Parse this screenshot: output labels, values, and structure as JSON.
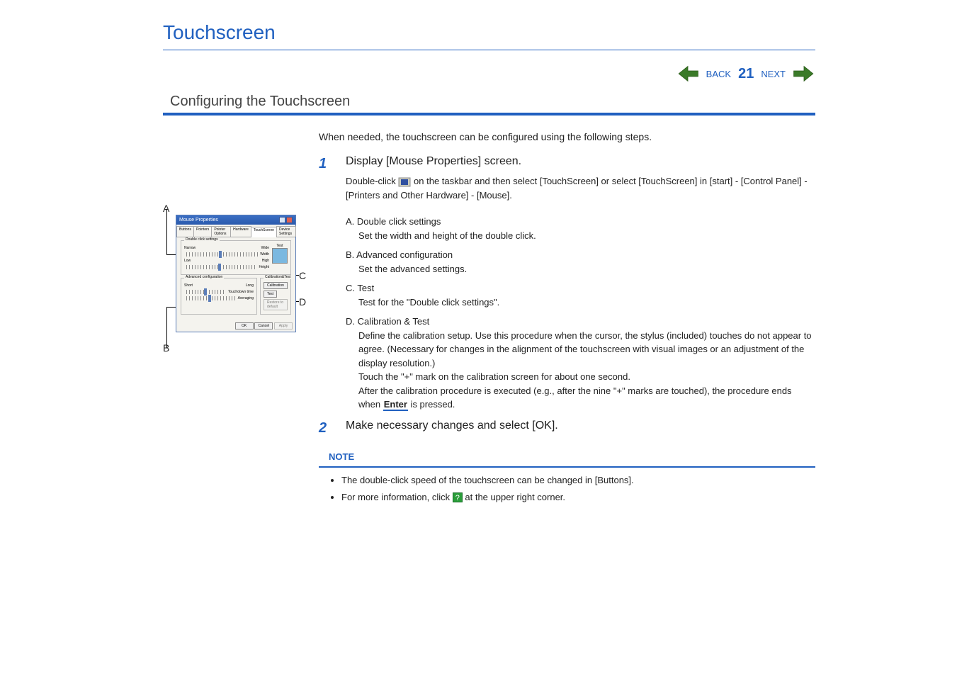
{
  "title": "Touchscreen",
  "nav": {
    "back": "BACK",
    "page": "21",
    "next": "NEXT"
  },
  "subtitle": "Configuring the Touchscreen",
  "intro": "When needed, the touchscreen can be configured using the following steps.",
  "step1": {
    "num": "1",
    "head": "Display [Mouse Properties] screen.",
    "sub_a": "Double-click ",
    "sub_b": " on the taskbar and then select [TouchScreen] or select [TouchScreen] in [start] - [Control Panel] - [Printers and Other Hardware] - [Mouse]."
  },
  "items": {
    "A": {
      "lab": "A.  Double click settings",
      "desc": "Set the width and height of the double click."
    },
    "B": {
      "lab": "B.  Advanced configuration",
      "desc": "Set the advanced settings."
    },
    "C": {
      "lab": "C.  Test",
      "desc": "Test for the \"Double click settings\"."
    },
    "D": {
      "lab": "D.  Calibration & Test",
      "desc1": "Define the calibration setup. Use this procedure when the cursor, the stylus (included) touches do not appear to agree.  (Necessary for changes in the alignment of the touchscreen with visual images or an adjustment of the display resolution.)",
      "desc2": "Touch the \"+\" mark on the calibration screen for about one second.",
      "desc3a": "After the calibration procedure is executed (e.g., after the nine \"+\" marks are touched), the procedure ends when ",
      "enter": "Enter",
      "desc3b": " is pressed."
    }
  },
  "step2": {
    "num": "2",
    "head": "Make necessary changes and select [OK]."
  },
  "note": {
    "head": "NOTE",
    "b1": "The double-click speed of the touchscreen can be changed in [Buttons].",
    "b2a": "For more information, click ",
    "b2b": " at the upper right corner."
  },
  "dialog": {
    "title": "Mouse Properties",
    "tabs": [
      "Buttons",
      "Pointers",
      "Pointer Options",
      "Hardware",
      "TouchScreen",
      "Device Settings"
    ],
    "fs1": "Double click settings",
    "narrow": "Narrow",
    "wide": "Wide",
    "width": "Width",
    "test": "Test",
    "low": "Low",
    "high": "High",
    "height": "Height",
    "fs2": "Advanced configuration",
    "short": "Short",
    "long": "Long",
    "tdtime": "Touchdown time",
    "avg": "Averaging",
    "fs3": "Calibration&Test",
    "calib": "Calibration",
    "testbtn": "Test",
    "restore": "Restore to default",
    "ok": "OK",
    "cancel": "Cancel",
    "apply": "Apply"
  },
  "callouts": {
    "A": "A",
    "B": "B",
    "C": "C",
    "D": "D"
  }
}
